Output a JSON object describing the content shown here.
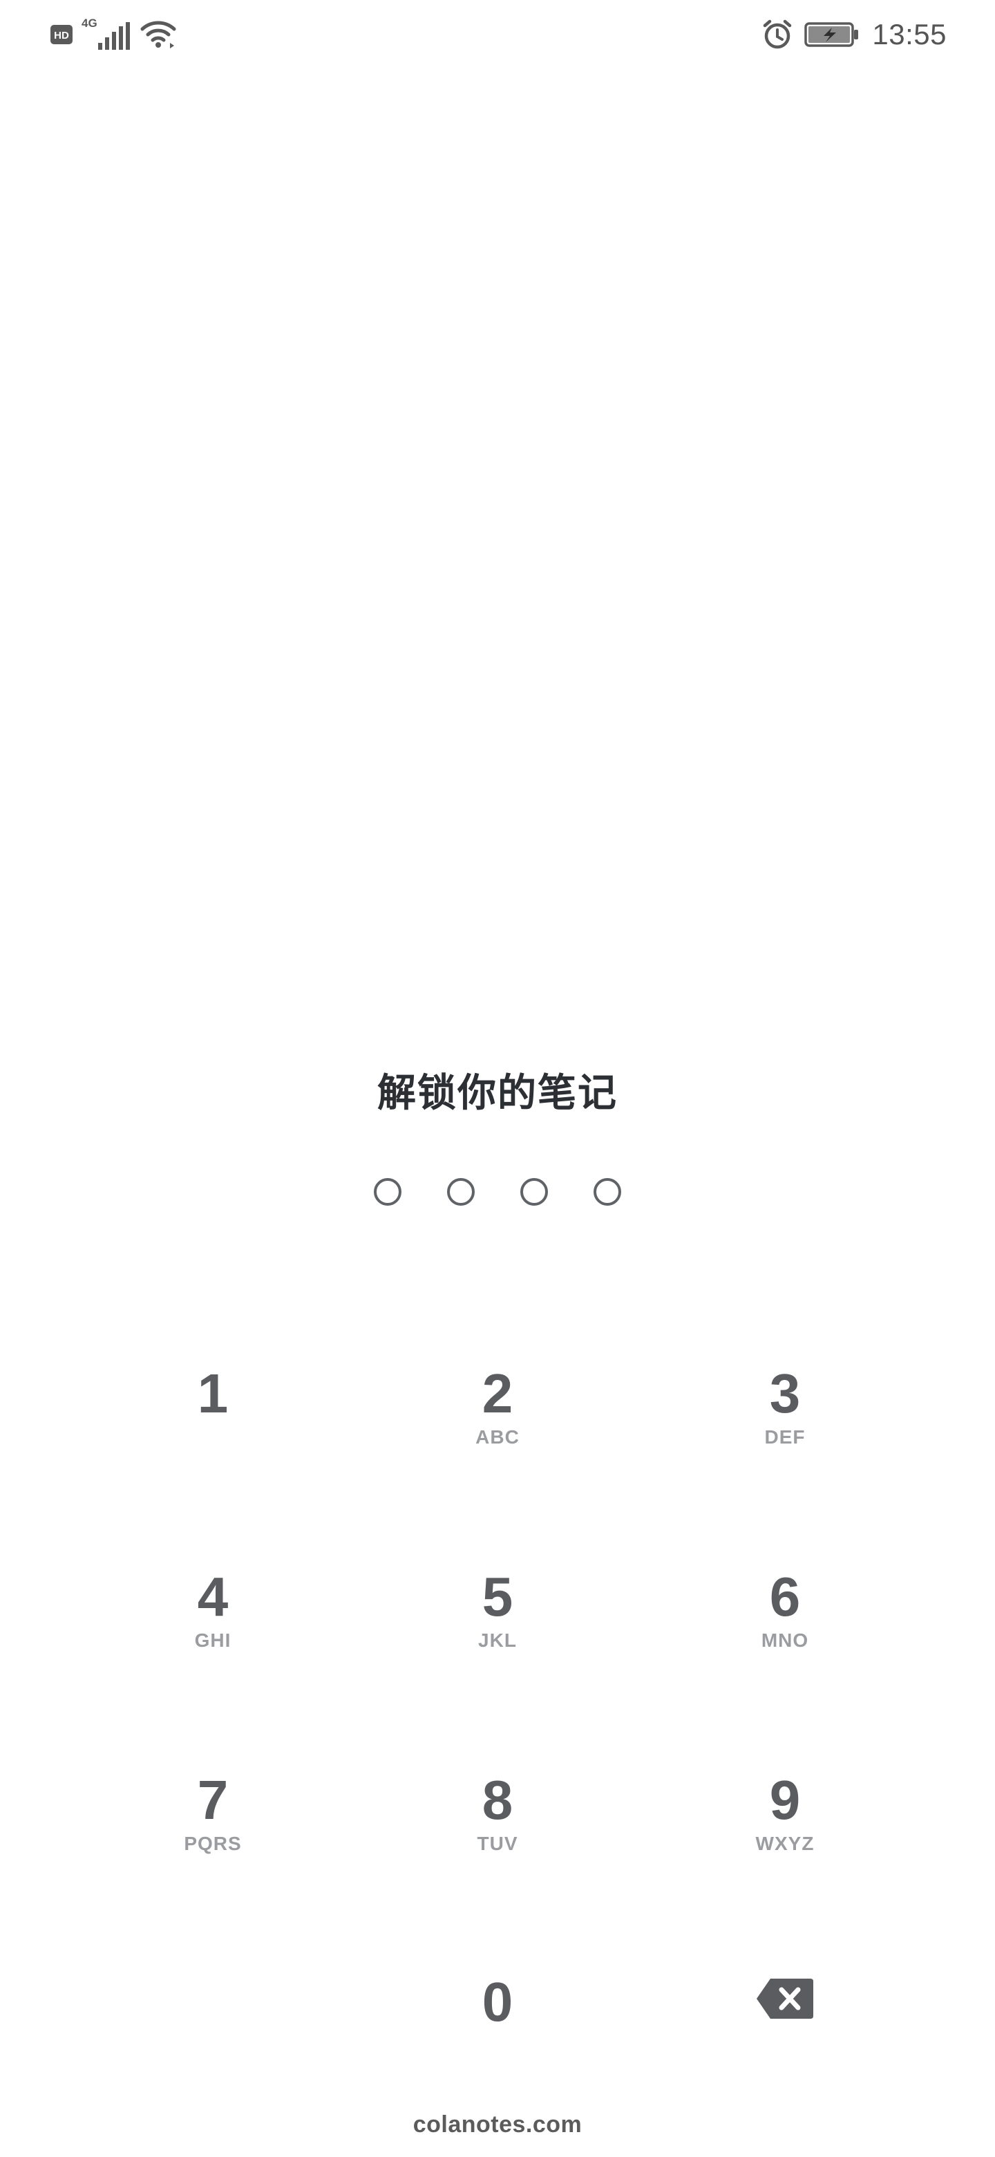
{
  "status_bar": {
    "hd_badge": "HD",
    "network_type": "4G",
    "time": "13:55",
    "icons": [
      "hd-icon",
      "signal-icon",
      "wifi-icon",
      "alarm-icon",
      "battery-charging-icon"
    ]
  },
  "lock": {
    "title": "解锁你的笔记",
    "pin_length": 4
  },
  "keypad": {
    "keys": [
      {
        "digit": "1",
        "letters": ""
      },
      {
        "digit": "2",
        "letters": "ABC"
      },
      {
        "digit": "3",
        "letters": "DEF"
      },
      {
        "digit": "4",
        "letters": "GHI"
      },
      {
        "digit": "5",
        "letters": "JKL"
      },
      {
        "digit": "6",
        "letters": "MNO"
      },
      {
        "digit": "7",
        "letters": "PQRS"
      },
      {
        "digit": "8",
        "letters": "TUV"
      },
      {
        "digit": "9",
        "letters": "WXYZ"
      },
      {
        "digit": "0",
        "letters": ""
      }
    ],
    "backspace_icon": "backspace-icon"
  },
  "footer": {
    "text": "colanotes.com"
  },
  "colors": {
    "background": "#ffffff",
    "title": "#2c2f33",
    "digit": "#5a5c60",
    "letters": "#9a9ca0"
  }
}
